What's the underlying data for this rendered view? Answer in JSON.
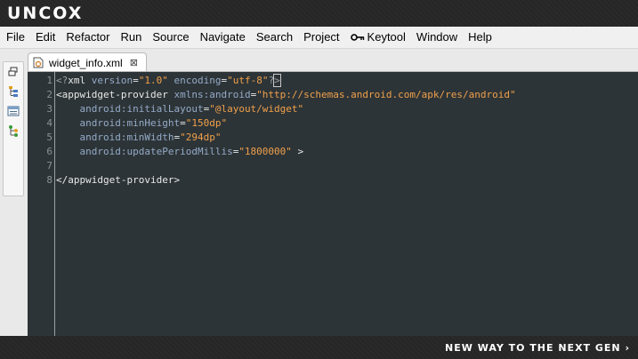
{
  "banner": {
    "logo": "UNCOX"
  },
  "menu": {
    "items": [
      "File",
      "Edit",
      "Refactor",
      "Run",
      "Source",
      "Navigate",
      "Search",
      "Project",
      "Keytool",
      "Window",
      "Help"
    ]
  },
  "editor": {
    "tab_title": "widget_info.xml",
    "close_glyph": "⊠",
    "line_numbers": [
      "1",
      "2",
      "3",
      "4",
      "5",
      "6",
      "7",
      "8"
    ]
  },
  "code": {
    "l1": {
      "open": "<?",
      "tag": "xml",
      "a1": "version",
      "v1": "\"1.0\"",
      "a2": "encoding",
      "v2": "\"utf-8\"",
      "q": "?",
      "close": ">"
    },
    "l2": {
      "tag": "<appwidget-provider",
      "attr": "xmlns:android",
      "eq": "=",
      "val": "\"http://schemas.android.com/apk/res/android\""
    },
    "l3": {
      "indent": "    ",
      "attr": "android:initialLayout",
      "eq": "=",
      "val": "\"@layout/widget\""
    },
    "l4": {
      "indent": "    ",
      "attr": "android:minHeight",
      "eq": "=",
      "val": "\"150dp\""
    },
    "l5": {
      "indent": "    ",
      "attr": "android:minWidth",
      "eq": "=",
      "val": "\"294dp\""
    },
    "l6": {
      "indent": "    ",
      "attr": "android:updatePeriodMillis",
      "eq": "=",
      "val": "\"1800000\"",
      "close": " >"
    },
    "l8": {
      "tag": "</appwidget-provider>"
    }
  },
  "footer": {
    "tagline": "NEW WAY TO THE NEXT GEN ›"
  }
}
